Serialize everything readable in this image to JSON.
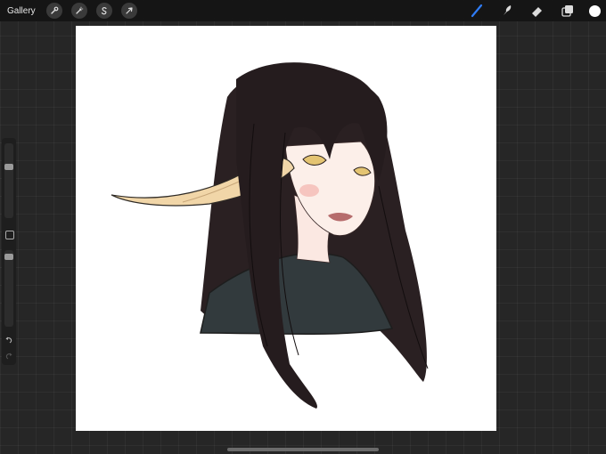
{
  "topbar": {
    "gallery_label": "Gallery",
    "left_tools": [
      "wrench-icon",
      "magic-wand-icon",
      "selection-icon",
      "transform-icon"
    ],
    "right_tools": [
      "brush-icon",
      "smudge-icon",
      "eraser-icon",
      "layers-icon"
    ],
    "active_tool": "brush-icon",
    "active_color": "#ffffff",
    "accent_color": "#2f7cf6"
  },
  "sidebar": {
    "brush_size": 0.3,
    "opacity": 0.05
  },
  "canvas": {
    "background": "#ffffff",
    "content": "drawing"
  }
}
